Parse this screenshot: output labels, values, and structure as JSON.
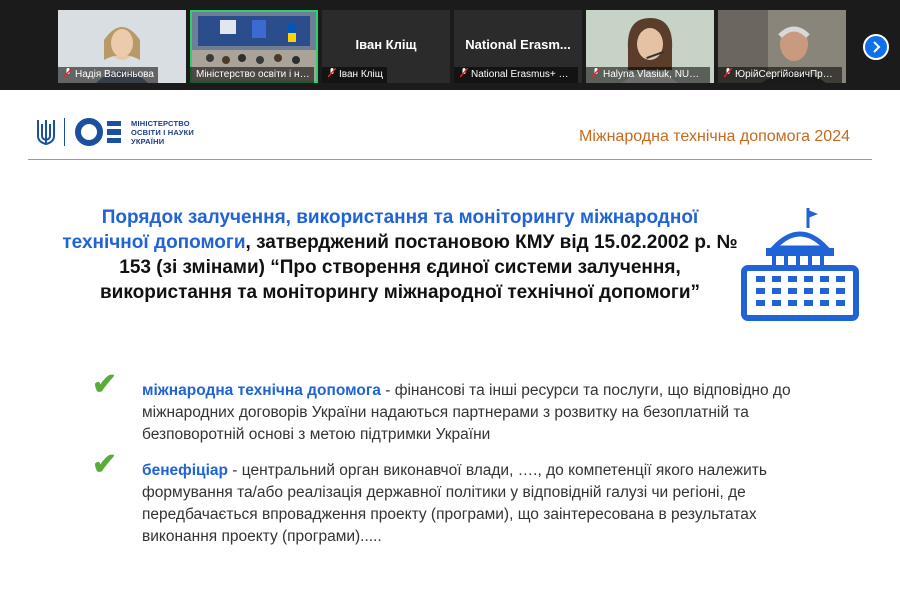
{
  "participants": [
    {
      "name": "Надія Васиньова",
      "muted": true,
      "bg": "#c9cfd6"
    },
    {
      "name": "Міністерство освіти і нау...",
      "muted": false,
      "active": true,
      "bg": "#9aa6b8"
    },
    {
      "name": "Іван Кліщ",
      "muted": true,
      "display": "Іван Кліщ"
    },
    {
      "name": "National Erasmus+ off...",
      "muted": true,
      "display": "National Erasm..."
    },
    {
      "name": "Halyna Vlasiuk, NUWEE",
      "muted": true,
      "bg": "#b9c7ba"
    },
    {
      "name": "ЮрійСергійовичПрой...",
      "muted": true,
      "bg": "#8f8a80"
    }
  ],
  "header": {
    "logo_line1": "МІНІСТЕРСТВО",
    "logo_line2": "ОСВІТИ І НАУКИ",
    "logo_line3": "УКРАЇНИ",
    "right_title": "Міжнародна технічна допомога 2024"
  },
  "heading": {
    "blue_part": "Порядок залучення, використання та моніторингу міжнародної технічної допомоги",
    "black_part": ", затверджений постановою КМУ від 15.02.2002 р. № 153 (зі змінами) “Про створення єдиної системи залучення, використання та моніторингу міжнародної технічної допомоги”"
  },
  "bullets": [
    {
      "check": "✔",
      "term": "міжнародна технічна допомога",
      "definition": " - фінансові та інші ресурси та послуги, що відповідно до міжнародних договорів України надаються партнерами з розвитку на безоплатній та безповоротній основі з метою підтримки України"
    },
    {
      "check": "✔",
      "term": "бенефіціар",
      "definition": " - центральний орган виконавчої влади, …., до компетенції якого належить формування та/або реалізація державної політики у відповідній галузі чи регіоні, де передбачається впровадження проекту (програми), що заінтересована в результатах виконання проекту (програми)....."
    }
  ],
  "colors": {
    "accent_blue": "#1f63d6",
    "accent_orange": "#c56a1e",
    "check_green": "#5aab3a",
    "active_tile": "#2fcf6e",
    "next_button": "#0e71eb"
  }
}
